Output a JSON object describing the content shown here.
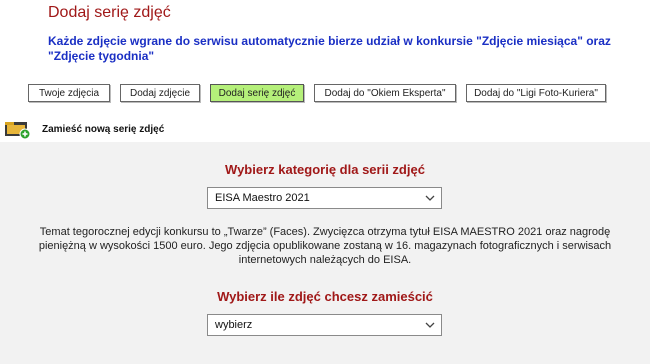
{
  "page": {
    "title": "Dodaj serię zdjęć",
    "intro": "Każde zdjęcie wgrane do serwisu automatycznie bierze udział w konkursie \"Zdjęcie miesiąca\" oraz \"Zdjęcie tygodnia\""
  },
  "tabs": [
    {
      "label": "Twoje zdjęcia"
    },
    {
      "label": "Dodaj zdjęcie"
    },
    {
      "label": "Dodaj serię zdjęć",
      "active": true
    },
    {
      "label": "Dodaj do \"Okiem Eksperta\""
    },
    {
      "label": "Dodaj do \"Ligi Foto-Kuriera\""
    }
  ],
  "section_header": {
    "label": "Zamieść nową serię zdjęć",
    "icon": "folder-add-icon"
  },
  "category": {
    "title": "Wybierz kategorię dla serii zdjęć",
    "selected": "EISA Maestro 2021",
    "description": "Temat tegorocznej edycji konkursu to „Twarze” (Faces). Zwycięzca otrzyma tytuł EISA MAESTRO 2021 oraz nagrodę pieniężną w wysokości 1500 euro. Jego zdjęcia opublikowane zostaną w 16. magazynach fotograficznych i serwisach internetowych należących do EISA."
  },
  "count": {
    "title": "Wybierz ile zdjęć chcesz zamieścić",
    "selected": "wybierz"
  },
  "colors": {
    "title": "#a01818",
    "intro": "#1a2fc4",
    "active_tab": "#b5f07a",
    "content_bg": "#f2f2f2"
  }
}
